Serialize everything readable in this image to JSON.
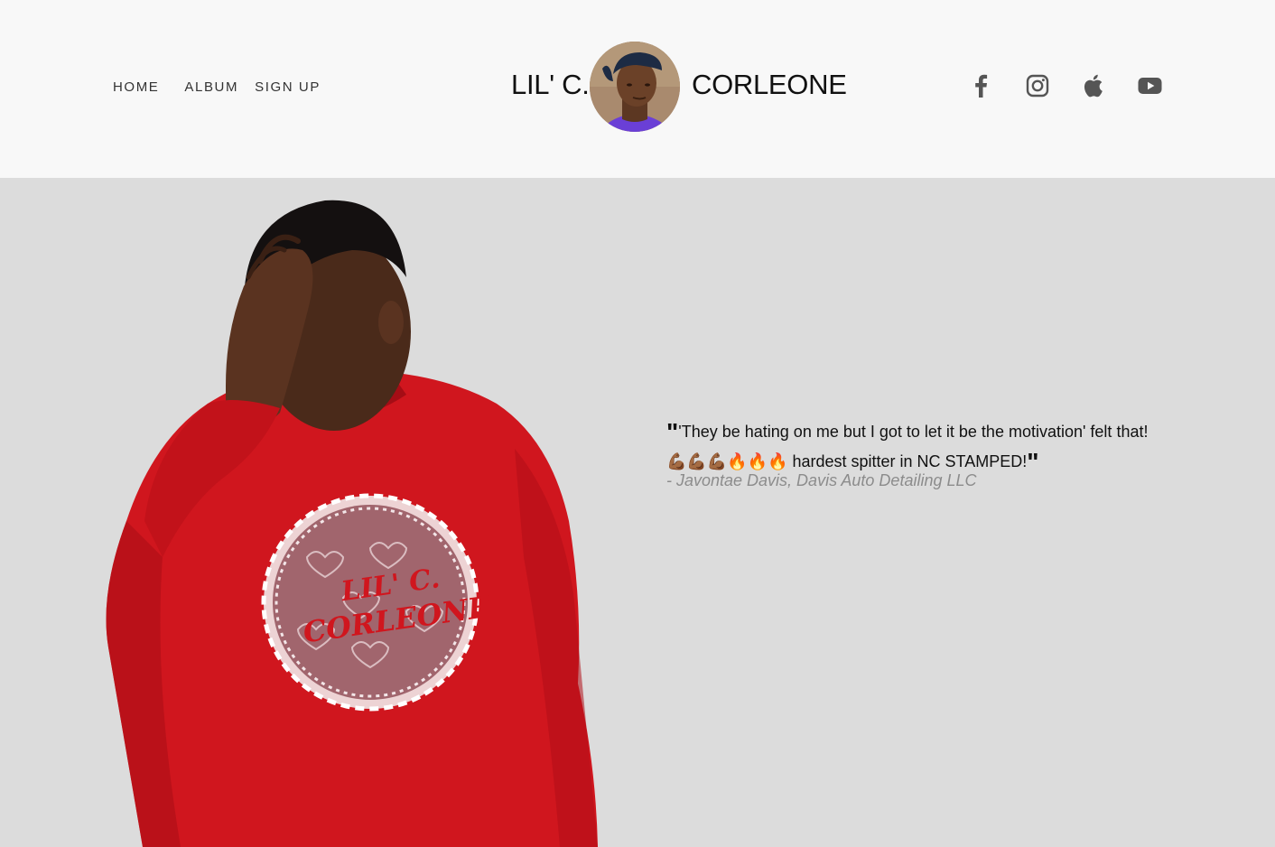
{
  "nav": {
    "items": [
      {
        "label": "HOME"
      },
      {
        "label": "ALBUM"
      },
      {
        "label": "SIGN UP"
      }
    ]
  },
  "brand": {
    "left": "LIL' C.",
    "right": "CORLEONE"
  },
  "social": {
    "icons": [
      "facebook-icon",
      "instagram-icon",
      "apple-music-icon",
      "youtube-icon"
    ]
  },
  "hero": {
    "shirt_print": [
      "LIL' C.",
      "CORLEONE"
    ]
  },
  "quote": {
    "open_mark": "\"",
    "text": "'They be hating on me but I got to let it be the motivation' felt that! 💪🏾💪🏾💪🏾🔥🔥🔥 hardest spitter in NC STAMPED!",
    "close_mark": "\"",
    "author": "- Javontae Davis, Davis Auto Detailing LLC"
  },
  "colors": {
    "header_bg": "#f8f8f8",
    "hero_bg": "#dcdcdc",
    "shirt_red": "#d0161e",
    "icon_gray": "#555555"
  }
}
